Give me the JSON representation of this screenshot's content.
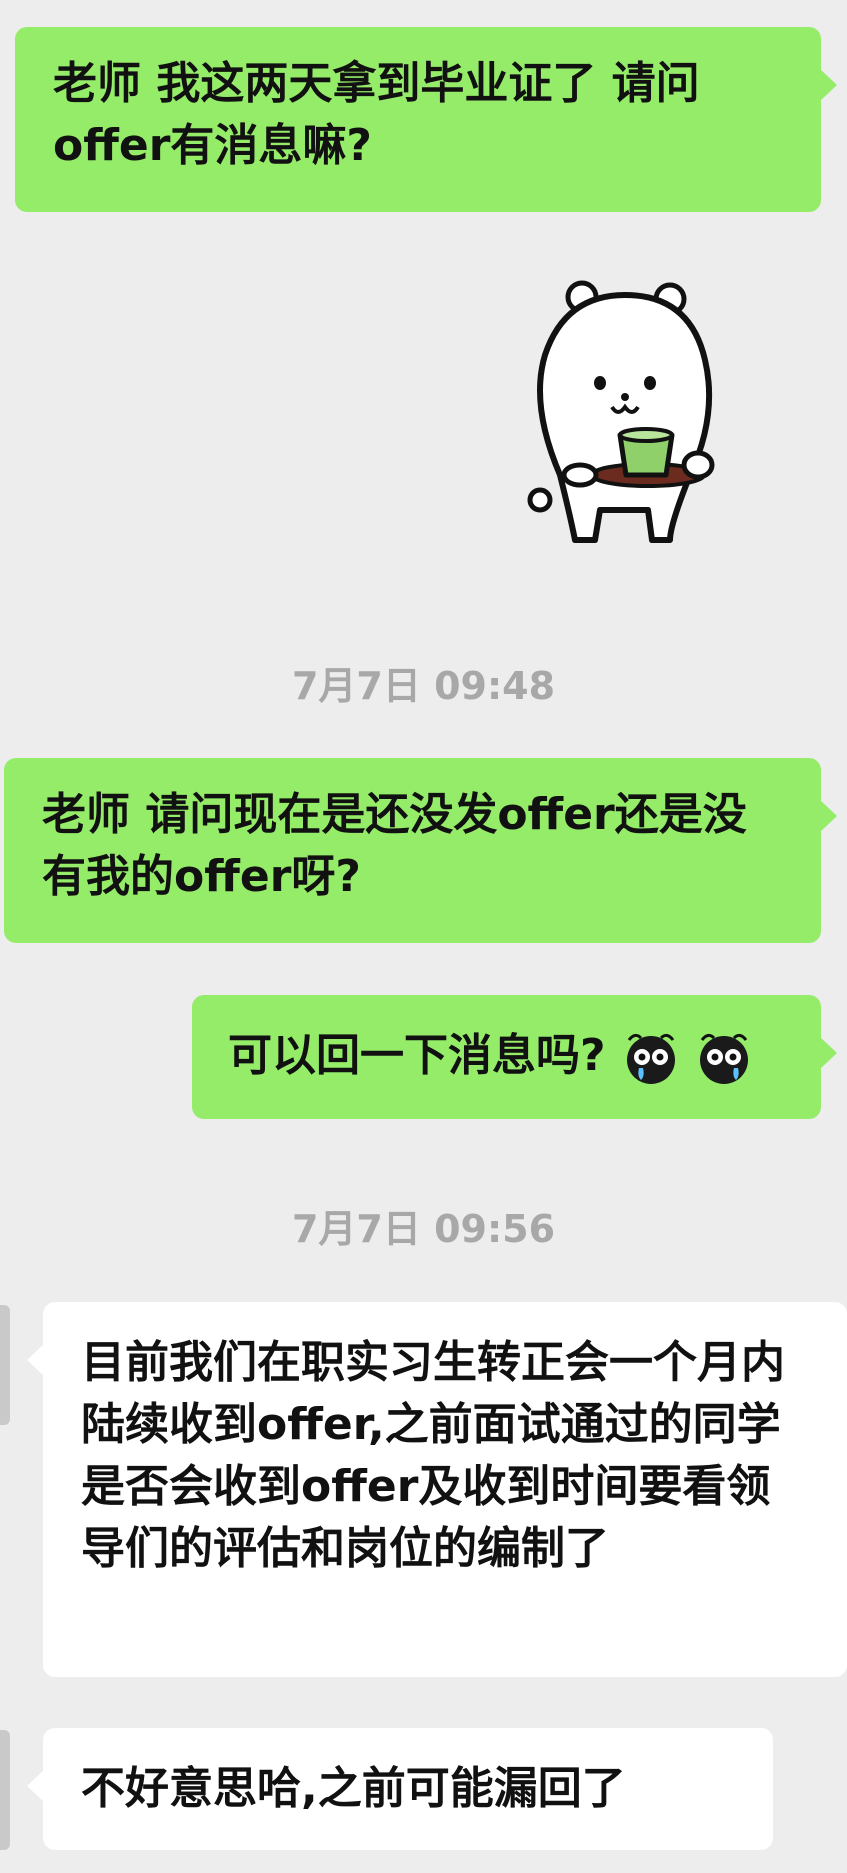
{
  "messages": {
    "m1": "老师 我这两天拿到毕业证了 请问offer有消息嘛?",
    "m2_sticker": "bear-with-cup-sticker",
    "ts1": "7月7日 09:48",
    "m3": "老师 请问现在是还没发offer还是没有我的offer呀?",
    "m4": "可以回一下消息吗?",
    "m4_emoji": "crying-emoji",
    "ts2": "7月7日 09:56",
    "m5": "目前我们在职实习生转正会一个月内陆续收到offer,之前面试通过的同学是否会收到offer及收到时间要看领导们的评估和岗位的编制了",
    "m6": "不好意思哈,之前可能漏回了"
  },
  "colors": {
    "background": "#ededed",
    "sent_bubble": "#95ec69",
    "received_bubble": "#ffffff",
    "timestamp": "#a8a8a8"
  }
}
